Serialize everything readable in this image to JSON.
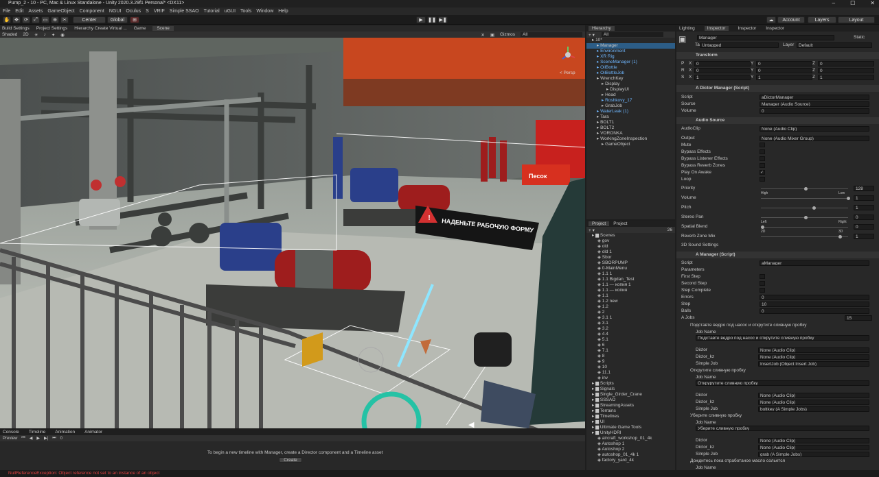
{
  "window": {
    "title": "Pump_2 - 10 - PC, Mac & Linux Standalone - Unity 2020.3.29f1 Personal* <DX11>",
    "min": "–",
    "max": "☐",
    "close": "✕"
  },
  "menu": [
    "File",
    "Edit",
    "Assets",
    "GameObject",
    "Component",
    "NGUI",
    "Oculus",
    "S",
    "VRIF",
    "Simple SSAO",
    "Tutorial",
    "uGUI",
    "Tools",
    "Window",
    "Help"
  ],
  "toolbar": {
    "center": "Center",
    "global": "Global",
    "account": "Account",
    "layers": "Layers",
    "layout": "Layout"
  },
  "scene_tabs": [
    "Build Settings",
    "Project Settings",
    "Hierarchy Create Virtual ...",
    "Game",
    "Scene"
  ],
  "scene_bar": {
    "shading": "Shaded",
    "mode": "2D",
    "gizmos": "Gizmos",
    "search": "All"
  },
  "viewport": {
    "sign_text": "НАДЕНЬТЕ РАБОЧУЮ ФОРМУ",
    "sand_sign": "Песок",
    "persp": "< Persp"
  },
  "timeline": {
    "tabs": [
      "Console",
      "Timeline",
      "Animation",
      "Animator"
    ],
    "preview": "Preview",
    "frame": "0",
    "message": "To begin a new timeline with Manager, create a Director component and a Timeline asset",
    "create": "Create"
  },
  "status": "NullReferenceException: Object reference not set to an instance of an object",
  "hierarchy": {
    "tab": "Hierarchy",
    "search": "All",
    "items": [
      {
        "t": "10*",
        "d": 0
      },
      {
        "t": "Manager",
        "d": 1
      },
      {
        "t": "Environment",
        "d": 1,
        "b": 1
      },
      {
        "t": "XR Rig",
        "d": 1,
        "b": 1
      },
      {
        "t": "SceneManager (1)",
        "d": 1,
        "b": 1
      },
      {
        "t": "OilBottle",
        "d": 1,
        "b": 1
      },
      {
        "t": "OilBottleJob",
        "d": 1,
        "b": 1
      },
      {
        "t": "WrenchKey",
        "d": 1
      },
      {
        "t": "Display",
        "d": 2
      },
      {
        "t": "DisplayUI",
        "d": 3
      },
      {
        "t": "Head",
        "d": 2
      },
      {
        "t": "Roshkovy_17",
        "d": 2,
        "b": 1
      },
      {
        "t": "GrabJob",
        "d": 2
      },
      {
        "t": "WaterLeak (1)",
        "d": 1,
        "b": 1
      },
      {
        "t": "Tara",
        "d": 1
      },
      {
        "t": "BOLT1",
        "d": 1
      },
      {
        "t": "BOLT2",
        "d": 1
      },
      {
        "t": "VORONKA",
        "d": 1
      },
      {
        "t": "WorkingZoneInspection",
        "d": 1
      },
      {
        "t": "GameObject",
        "d": 2
      }
    ]
  },
  "project": {
    "tabs": [
      "Project",
      "Project"
    ],
    "count": "26",
    "items": [
      {
        "t": "Scenes",
        "d": 0
      },
      {
        "t": "gov",
        "d": 1
      },
      {
        "t": "old",
        "d": 1
      },
      {
        "t": "old 1",
        "d": 1
      },
      {
        "t": "Sbor",
        "d": 1
      },
      {
        "t": "SBORPUMP",
        "d": 1
      },
      {
        "t": "0-MainMenu",
        "d": 1
      },
      {
        "t": "1.1 1",
        "d": 1
      },
      {
        "t": "1.1 Bigdan_Test",
        "d": 1
      },
      {
        "t": "1.1 — копия 1",
        "d": 1
      },
      {
        "t": "1.1 — копия",
        "d": 1
      },
      {
        "t": "1.1",
        "d": 1
      },
      {
        "t": "1.2 new",
        "d": 1
      },
      {
        "t": "1.2",
        "d": 1
      },
      {
        "t": "2",
        "d": 1
      },
      {
        "t": "3.1 1",
        "d": 1
      },
      {
        "t": "3.1",
        "d": 1
      },
      {
        "t": "3.2",
        "d": 1
      },
      {
        "t": "4.4",
        "d": 1
      },
      {
        "t": "5.1",
        "d": 1
      },
      {
        "t": "6",
        "d": 1
      },
      {
        "t": "7.1",
        "d": 1
      },
      {
        "t": "8",
        "d": 1
      },
      {
        "t": "9",
        "d": 1
      },
      {
        "t": "10",
        "d": 1
      },
      {
        "t": "11.1",
        "d": 1
      },
      {
        "t": "inv",
        "d": 1
      },
      {
        "t": "Scripts",
        "d": 0
      },
      {
        "t": "Signals",
        "d": 0
      },
      {
        "t": "Single_Girder_Crane",
        "d": 0
      },
      {
        "t": "SSSAO",
        "d": 0
      },
      {
        "t": "StreamingAssets",
        "d": 0
      },
      {
        "t": "Terrains",
        "d": 0
      },
      {
        "t": "Timelines",
        "d": 0
      },
      {
        "t": "UI",
        "d": 0
      },
      {
        "t": "Ultimate Game Tools",
        "d": 0
      },
      {
        "t": "UnityHDRI",
        "d": 0
      },
      {
        "t": "aircraft_workshop_01_4k",
        "d": 1
      },
      {
        "t": "Autoshop 1",
        "d": 1
      },
      {
        "t": "Autoshop 2",
        "d": 1
      },
      {
        "t": "autoshop_01_4k 1",
        "d": 1
      },
      {
        "t": "factory_yard_4k",
        "d": 1
      }
    ]
  },
  "inspector": {
    "tabs": [
      "Lighting",
      "Inspector",
      "Inspector",
      "Inspector"
    ],
    "name": "Manager",
    "static": "Static",
    "tag_label": "Tag",
    "tag": "Untagged",
    "layer_label": "Layer",
    "layer": "Default",
    "transform": {
      "title": "Transform",
      "rows": [
        [
          "P",
          "0",
          "0",
          "0"
        ],
        [
          "R",
          "0",
          "0",
          "0"
        ],
        [
          "S",
          "1",
          "1",
          "1"
        ]
      ]
    },
    "dictor": {
      "title": "A Dictor Manager (Script)",
      "script_label": "Script",
      "script": "aDictorManager",
      "source_label": "Source",
      "source": "Manager (Audio Source)",
      "volume_label": "Volume",
      "volume": "0"
    },
    "audio": {
      "title": "Audio Source",
      "clip_label": "AudioClip",
      "clip": "None (Audio Clip)",
      "output_label": "Output",
      "output": "None (Audio Mixer Group)",
      "checks": [
        "Mute",
        "Bypass Effects",
        "Bypass Listener Effects",
        "Bypass Reverb Zones",
        "Play On Awake",
        "Loop"
      ],
      "sliders": [
        {
          "l": "Priority",
          "v": "128",
          "f": 0.5,
          "a": "High",
          "b": "Low"
        },
        {
          "l": "Volume",
          "v": "1",
          "f": 1
        },
        {
          "l": "Pitch",
          "v": "1",
          "f": 0.6
        },
        {
          "l": "Stereo Pan",
          "v": "0",
          "f": 0.5,
          "a": "Left",
          "b": "Right"
        },
        {
          "l": "Spatial Blend",
          "v": "0",
          "f": 0,
          "a": "2D",
          "b": "3D"
        },
        {
          "l": "Reverb Zone Mix",
          "v": "1",
          "f": 0.9
        }
      ],
      "s3d": "3D Sound Settings"
    },
    "manager": {
      "title": "A Manager (Script)",
      "script_label": "Script",
      "script": "aManager",
      "params": "Parameters",
      "rows": [
        [
          "First Step",
          ""
        ],
        [
          "Second Step",
          ""
        ],
        [
          "Step Complete",
          ""
        ],
        [
          "Errors",
          "0"
        ],
        [
          "Step",
          "10"
        ],
        [
          "Balls",
          "0"
        ]
      ],
      "jobs_label": "A Jobs",
      "jobs_count": "15",
      "jobs": [
        {
          "h": "Подставте ведро под насос и открутите сливную пробку",
          "name": "Подставте ведро под насос и открутите сливную пробку",
          "dictor": "None (Audio Clip)",
          "dictor_kz": "None (Audio Clip)",
          "simple": "InsertJob (Object Insert Job)"
        },
        {
          "h": "Открутите сливную пробку",
          "name": "Открурутите сливную пробку",
          "dictor": "None (Audio Clip)",
          "dictor_kz": "None (Audio Clip)",
          "simple": "boltkey (A Simple Jobs)"
        },
        {
          "h": "Уберите сливную пробку",
          "name": "Уберите сливную пробку",
          "dictor": "None (Audio Clip)",
          "dictor_kz": "None (Audio Clip)",
          "simple": "grab (A Simple Jobs)"
        }
      ],
      "last": "Дождитесь пока отработаное масло сольется",
      "labels": {
        "job_name": "Job Name",
        "dictor": "Dictor",
        "dictor_kz": "Dictor_kz",
        "simple": "Simple Job"
      }
    }
  }
}
